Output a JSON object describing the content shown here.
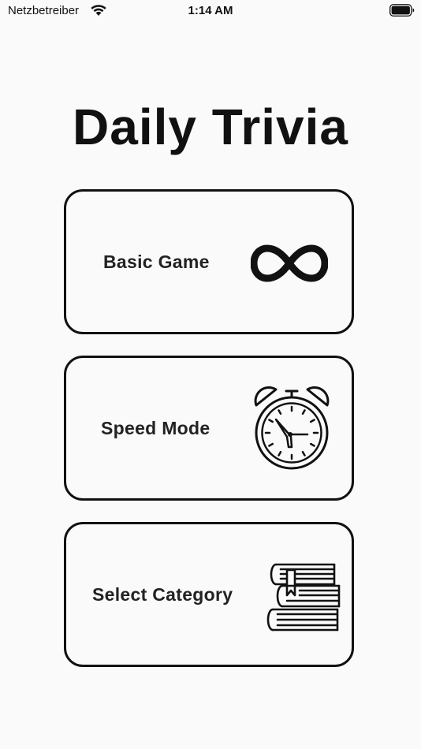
{
  "status_bar": {
    "carrier": "Netzbetreiber",
    "time": "1:14 AM",
    "wifi_icon": "wifi-icon",
    "battery_icon": "battery-icon"
  },
  "title": "Daily Trivia",
  "menu": [
    {
      "label": "Basic Game",
      "icon": "infinity-icon"
    },
    {
      "label": "Speed Mode",
      "icon": "alarm-clock-icon"
    },
    {
      "label": "Select Category",
      "icon": "books-icon"
    }
  ],
  "colors": {
    "background": "#fafafa",
    "foreground": "#111111"
  }
}
